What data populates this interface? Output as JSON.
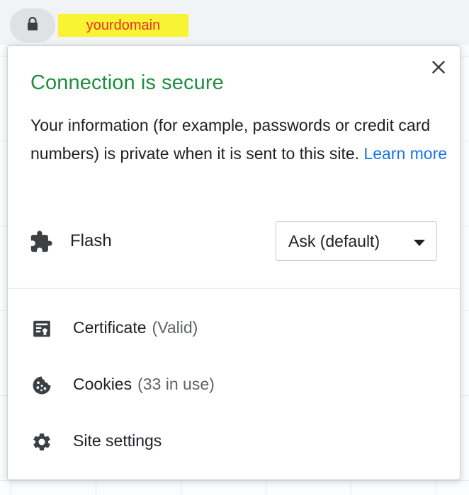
{
  "address_bar": {
    "domain": "yourdomain",
    "lock_icon": "lock-icon"
  },
  "bubble": {
    "title": "Connection is secure",
    "description": "Your information (for example, passwords or credit card numbers) is private when it is sent to this site.",
    "learn_more": "Learn more",
    "close_icon": "close-icon"
  },
  "permission": {
    "label": "Flash",
    "icon": "puzzle-piece-icon",
    "value": "Ask (default)"
  },
  "menu": {
    "certificate": {
      "label": "Certificate",
      "status": "(Valid)",
      "icon": "certificate-icon"
    },
    "cookies": {
      "label": "Cookies",
      "status": "(33 in use)",
      "icon": "cookie-icon"
    },
    "site_settings": {
      "label": "Site settings",
      "icon": "gear-icon"
    }
  },
  "colors": {
    "secure_title": "#1e8e3e",
    "link": "#1a73e8",
    "domain_highlight": "#f9f433",
    "domain_text": "#e8312c",
    "icon": "#3c4043"
  }
}
